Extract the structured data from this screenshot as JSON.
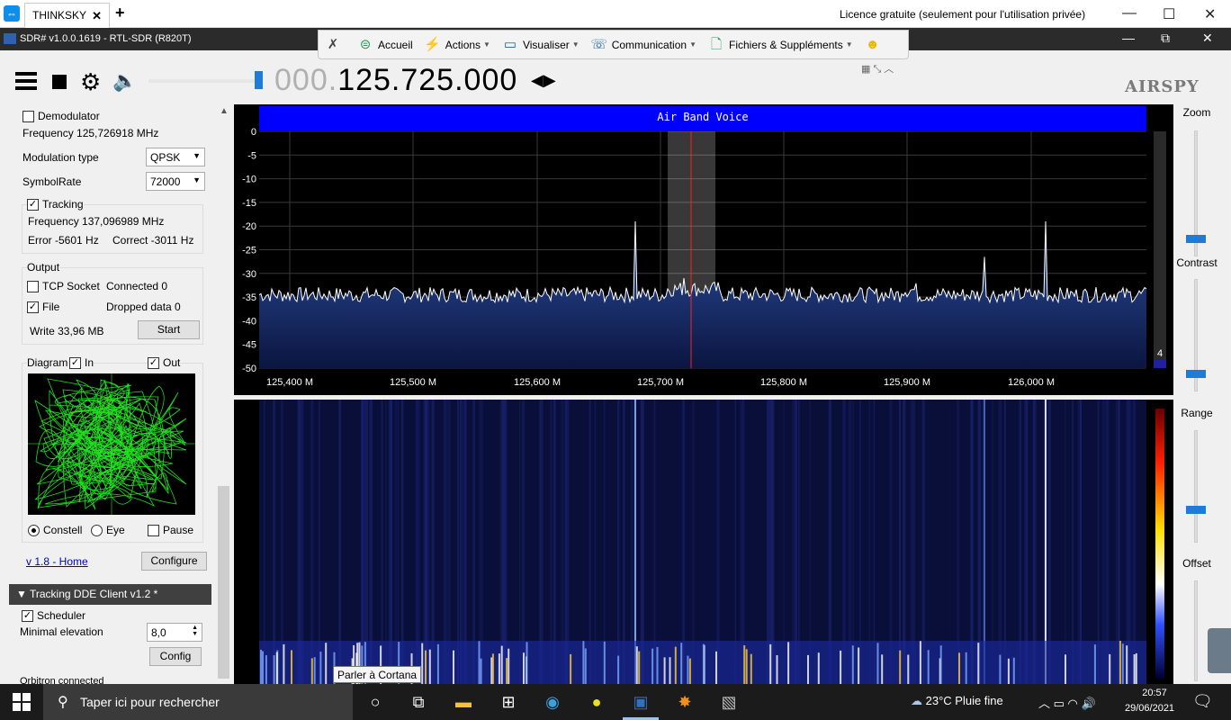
{
  "teamviewer": {
    "tab_title": "THINKSKY",
    "tab_close": "✕",
    "new_tab": "+",
    "licence": "Licence gratuite (seulement pour l'utilisation privée)",
    "toolbar": {
      "home": "Accueil",
      "actions": "Actions",
      "view": "Visualiser",
      "communication": "Communication",
      "files": "Fichiers & Suppléments"
    }
  },
  "sdr": {
    "title": "SDR# v1.0.0.1619 - RTL-SDR (R820T)",
    "freq_dim": "000.",
    "freq_main": "125.725.000",
    "logo": "AIRSPY"
  },
  "left": {
    "demodulator_label": "Demodulator",
    "frequency": "Frequency 125,726918 MHz",
    "modulation_label": "Modulation type",
    "modulation_value": "QPSK",
    "symbolrate_label": "SymbolRate",
    "symbolrate_value": "72000",
    "tracking_label": "Tracking",
    "tracking_frequency": "Frequency 137,096989 MHz",
    "error": "Error -5601 Hz",
    "correct": "Correct -3011 Hz",
    "output_label": "Output",
    "tcp_label": "TCP Socket",
    "connected": "Connected 0",
    "file_label": "File",
    "dropped": "Dropped data 0",
    "write": "Write 33,96 MB",
    "start_button": "Start",
    "diagram_label": "Diagram",
    "in_label": "In",
    "out_label": "Out",
    "constell_label": "Constell",
    "eye_label": "Eye",
    "pause_label": "Pause",
    "version_link": "v 1.8 - Home",
    "configure_button": "Configure",
    "dde_header": "Tracking DDE Client v1.2 *",
    "scheduler_label": "Scheduler",
    "min_elevation_label": "Minimal elevation",
    "min_elevation_value": "8,0",
    "config_button": "Config",
    "orbitron": "Orbitron connected"
  },
  "spectrum": {
    "title": "Air Band Voice",
    "y_ticks": [
      "0",
      "-5",
      "-10",
      "-15",
      "-20",
      "-25",
      "-30",
      "-35",
      "-40",
      "-45",
      "-50"
    ],
    "x_ticks": [
      "125,400 M",
      "125,500 M",
      "125,600 M",
      "125,700 M",
      "125,800 M",
      "125,900 M",
      "126,000 M"
    ],
    "right_marker": "4"
  },
  "right_panel": {
    "zoom": "Zoom",
    "contrast": "Contrast",
    "range": "Range",
    "offset": "Offset"
  },
  "tooltip": "Parler à Cortana",
  "taskbar": {
    "search_placeholder": "Taper ici pour rechercher",
    "weather": "23°C  Pluie fine",
    "time": "20:57",
    "date": "29/06/2021"
  }
}
